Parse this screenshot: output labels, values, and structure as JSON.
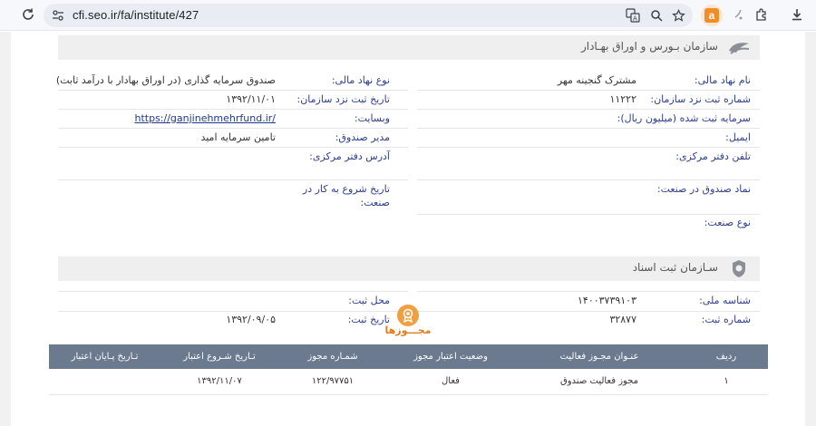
{
  "browser": {
    "url": "cfi.seo.ir/fa/institute/427",
    "ext_letter": "a"
  },
  "boors": {
    "title": "سازمان بـورس و اوراق بهـادار",
    "fields": {
      "name_label": "نام نهاد مالی:",
      "name_value": "مشترک گنجینه مهر",
      "type_label": "نوع نهاد مالی:",
      "type_value": "صندوق سرمایه گذاری (در اوراق بهادار با درآمد ثابت)",
      "regno_label": "شماره ثبت نزد سازمان:",
      "regno_value": "۱۱۲۲۲",
      "regdate_label": "تاریخ ثبت نزد سازمان:",
      "regdate_value": "۱۳۹۲/۱۱/۰۱",
      "capital_label": "سرمایه ثبت شده (میلیون ریال):",
      "website_label": "وبسایت:",
      "website_value": "https://ganjinehmehrfund.ir/",
      "email_label": "ایمیل:",
      "manager_label": "مدیر صندوق:",
      "manager_value": "تامین سرمایه امید",
      "phone_label": "تلفن دفتر مرکزی:",
      "address_label": "آدرس دفتر مرکزی:",
      "symbol_label": "نماد صندوق در صنعت:",
      "start_label_1": "تاریخ شروع به کار در",
      "start_label_2": "صنعت:",
      "industry_label": "نوع صنعت:"
    }
  },
  "sabt": {
    "title": "سـازمان ثبت اسناد",
    "fields": {
      "national_id_label": "شناسه ملی:",
      "national_id_value": "۱۴۰۰۳۷۳۹۱۰۳",
      "place_label": "محل ثبت:",
      "regno_label": "شماره ثبت:",
      "regno_value": "۳۲۸۷۷",
      "regdate_label": "تاریخ ثبت:",
      "regdate_value": "۱۳۹۲/۰۹/۰۵"
    }
  },
  "licenses": {
    "heading": "مجـــوزها",
    "columns": [
      "ردیف",
      "عنـوان مجـوز فعالیت",
      "وضعیت اعتبار مجوز",
      "شمـاره مجوز",
      "تـاریخ شـروع اعتبار",
      "تـاریخ پـایان اعتبار"
    ],
    "rows": [
      [
        "۱",
        "مجوز فعالیت صندوق",
        "فعال",
        "۱۲۲/۹۷۷۵۱",
        "۱۳۹۲/۱۱/۰۷",
        ""
      ]
    ]
  }
}
